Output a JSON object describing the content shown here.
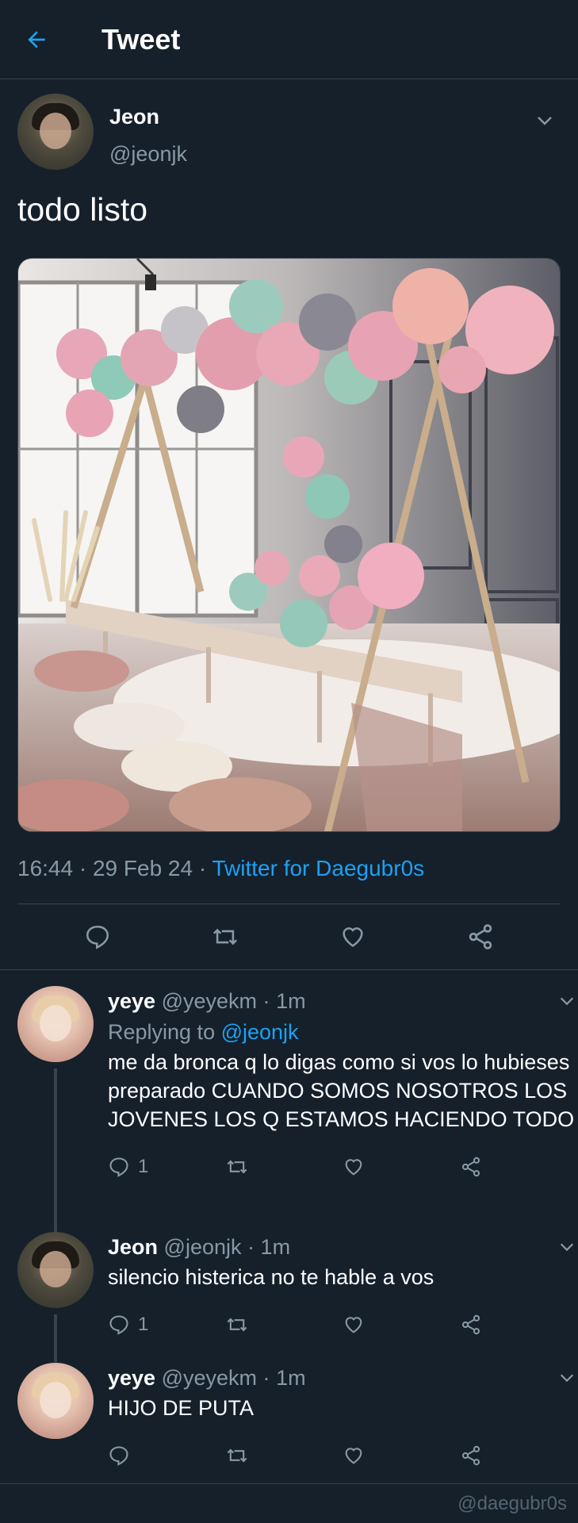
{
  "header": {
    "title": "Tweet"
  },
  "main_tweet": {
    "name": "Jeon",
    "handle": "@jeonjk",
    "text": "todo listo",
    "time": "16:44",
    "date": "29 Feb 24",
    "source": "Twitter for Daegubr0s",
    "meta_sep": " · "
  },
  "replies": [
    {
      "name": "yeye",
      "handle": "@yeyekm",
      "age": "1m",
      "replying_label": "Replying to ",
      "replying_to": "@jeonjk",
      "text": "me da bronca q lo digas como si vos lo hubieses preparado CUANDO SOMOS NOSOTROS LOS JOVENES LOS Q ESTAMOS HACIENDO TODO",
      "reply_count": "1"
    },
    {
      "name": "Jeon",
      "handle": "@jeonjk",
      "age": "1m",
      "text": "silencio histerica no te hable a vos",
      "reply_count": "1"
    },
    {
      "name": "yeye",
      "handle": "@yeyekm",
      "age": "1m",
      "text": "HIJO DE PUTA",
      "reply_count": ""
    }
  ],
  "watermark": "@daegubr0s",
  "colors": {
    "background": "#15202b",
    "accent": "#1da1f2",
    "muted": "#8899a6",
    "divider": "#38444d"
  },
  "icons": [
    "back-arrow-icon",
    "chevron-down-icon",
    "reply-icon",
    "retweet-icon",
    "like-icon",
    "share-icon"
  ]
}
